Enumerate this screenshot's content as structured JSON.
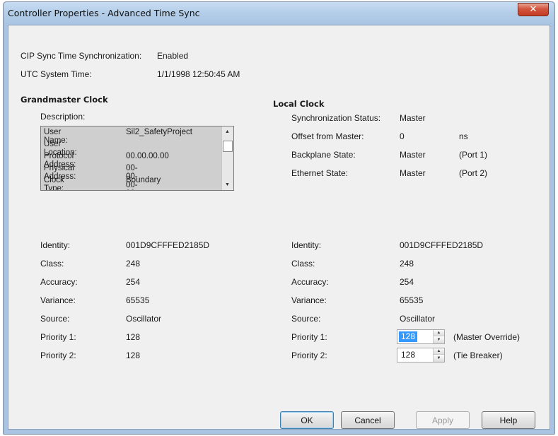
{
  "window": {
    "title": "Controller Properties - Advanced Time Sync",
    "close_glyph": "✕"
  },
  "top": {
    "cip_label": "CIP Sync Time Synchronization:",
    "cip_value": "Enabled",
    "utc_label": "UTC System Time:",
    "utc_value": "1/1/1998 12:50:45 AM"
  },
  "grandmaster": {
    "heading": "Grandmaster Clock",
    "description_label": "Description:",
    "list": [
      {
        "key": "User Name:",
        "value": "Sil2_SafetyProject"
      },
      {
        "key": "User Location:",
        "value": ""
      },
      {
        "key": "Protocol Address:",
        "value": "00.00.00.00"
      },
      {
        "key": "Physical Address:",
        "value": "00-00-00-00"
      },
      {
        "key": "Clock Type:",
        "value": "Boundary"
      }
    ],
    "fields": [
      {
        "label": "Identity:",
        "value": "001D9CFFFED2185D"
      },
      {
        "label": "Class:",
        "value": "248"
      },
      {
        "label": "Accuracy:",
        "value": "254"
      },
      {
        "label": "Variance:",
        "value": "65535"
      },
      {
        "label": "Source:",
        "value": "Oscillator"
      },
      {
        "label": "Priority 1:",
        "value": "128"
      },
      {
        "label": "Priority 2:",
        "value": "128"
      }
    ]
  },
  "local": {
    "heading": "Local Clock",
    "status_rows": [
      {
        "label": "Synchronization Status:",
        "value": "Master",
        "extra": ""
      },
      {
        "label": "Offset from Master:",
        "value": "0",
        "extra": "ns"
      },
      {
        "label": "Backplane State:",
        "value": "Master",
        "extra": "(Port 1)"
      },
      {
        "label": "Ethernet State:",
        "value": "Master",
        "extra": "(Port 2)"
      }
    ],
    "fields": [
      {
        "label": "Identity:",
        "value": "001D9CFFFED2185D"
      },
      {
        "label": "Class:",
        "value": "248"
      },
      {
        "label": "Accuracy:",
        "value": "254"
      },
      {
        "label": "Variance:",
        "value": "65535"
      },
      {
        "label": "Source:",
        "value": "Oscillator"
      }
    ],
    "priority1": {
      "label": "Priority 1:",
      "value": "128",
      "note": "(Master Override)"
    },
    "priority2": {
      "label": "Priority 2:",
      "value": "128",
      "note": "(Tie Breaker)"
    }
  },
  "buttons": {
    "ok": "OK",
    "cancel": "Cancel",
    "apply": "Apply",
    "help": "Help"
  },
  "colors": {
    "accent": "#3399ff",
    "close": "#c43b22",
    "listbox_bg": "#cfcfcf"
  }
}
